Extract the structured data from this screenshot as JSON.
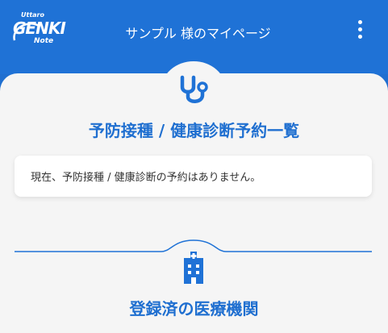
{
  "header": {
    "logo": {
      "top": "Uttaro",
      "main": "GENKI",
      "sub": "Note",
      "icon": "genki-note-logo"
    },
    "title": "サンプル 様のマイページ",
    "menu_icon": "vertical-dots-icon"
  },
  "sections": [
    {
      "icon": "stethoscope-icon",
      "title": "予防接種 / 健康診断予約一覧",
      "message": "現在、予防接種 / 健康診断の予約はありません。"
    },
    {
      "icon": "hospital-icon",
      "title": "登録済の医療機関"
    }
  ],
  "colors": {
    "primary": "#1f72d6",
    "background": "#f5f5f5",
    "card": "#ffffff",
    "text": "#333333"
  }
}
